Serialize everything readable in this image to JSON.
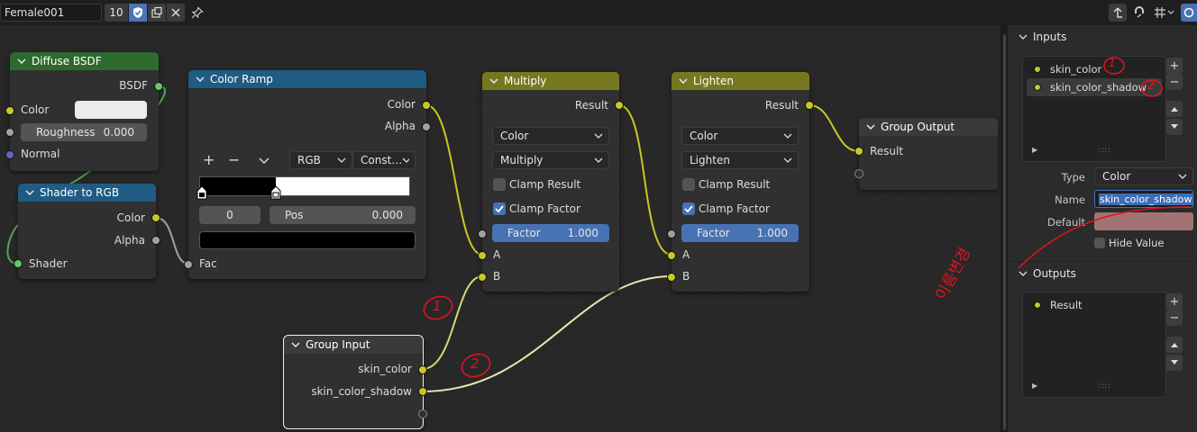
{
  "header": {
    "node_tree_name": "Female001",
    "user_count": "10"
  },
  "nodes": {
    "diffuse": {
      "title": "Diffuse BSDF",
      "out_bsdf": "BSDF",
      "color": "Color",
      "roughness_label": "Roughness",
      "roughness_value": "0.000",
      "normal": "Normal"
    },
    "shader_rgb": {
      "title": "Shader to RGB",
      "out_color": "Color",
      "out_alpha": "Alpha",
      "in_shader": "Shader"
    },
    "color_ramp": {
      "title": "Color Ramp",
      "out_color": "Color",
      "out_alpha": "Alpha",
      "mode": "RGB",
      "interpolation": "Const…",
      "stop_index": "0",
      "pos_label": "Pos",
      "pos_value": "0.000",
      "in_fac": "Fac"
    },
    "multiply": {
      "title": "Multiply",
      "out_result": "Result",
      "data_type": "Color",
      "blend_mode": "Multiply",
      "clamp_result": "Clamp Result",
      "clamp_factor": "Clamp Factor",
      "factor_label": "Factor",
      "factor_value": "1.000",
      "in_a": "A",
      "in_b": "B"
    },
    "lighten": {
      "title": "Lighten",
      "out_result": "Result",
      "data_type": "Color",
      "blend_mode": "Lighten",
      "clamp_result": "Clamp Result",
      "clamp_factor": "Clamp Factor",
      "factor_label": "Factor",
      "factor_value": "1.000",
      "in_a": "A",
      "in_b": "B"
    },
    "group_output": {
      "title": "Group Output",
      "in_result": "Result"
    },
    "group_input": {
      "title": "Group Input",
      "out_skin_color": "skin_color",
      "out_skin_color_shadow": "skin_color_shadow"
    }
  },
  "panel": {
    "inputs_header": "Inputs",
    "inputs": [
      "skin_color",
      "skin_color_shadow"
    ],
    "type_label": "Type",
    "type_value": "Color",
    "name_label": "Name",
    "name_value": "skin_color_shadow",
    "default_label": "Default",
    "default_color": "#a37373",
    "hide_value_label": "Hide Value",
    "outputs_header": "Outputs",
    "outputs": [
      "Result"
    ]
  },
  "annotations": {
    "circle_1": "1",
    "circle_2": "2",
    "handwritten_note": "이름변경"
  },
  "colors": {
    "diffuse_header": "#2e6a2e",
    "shader_rgb_header": "#1f5b83",
    "color_ramp_header": "#1f5b83",
    "mix_header": "#76781f",
    "socket_color": "#c7c729",
    "accent_blue": "#4772b3",
    "annotation_red": "#e0141e"
  }
}
